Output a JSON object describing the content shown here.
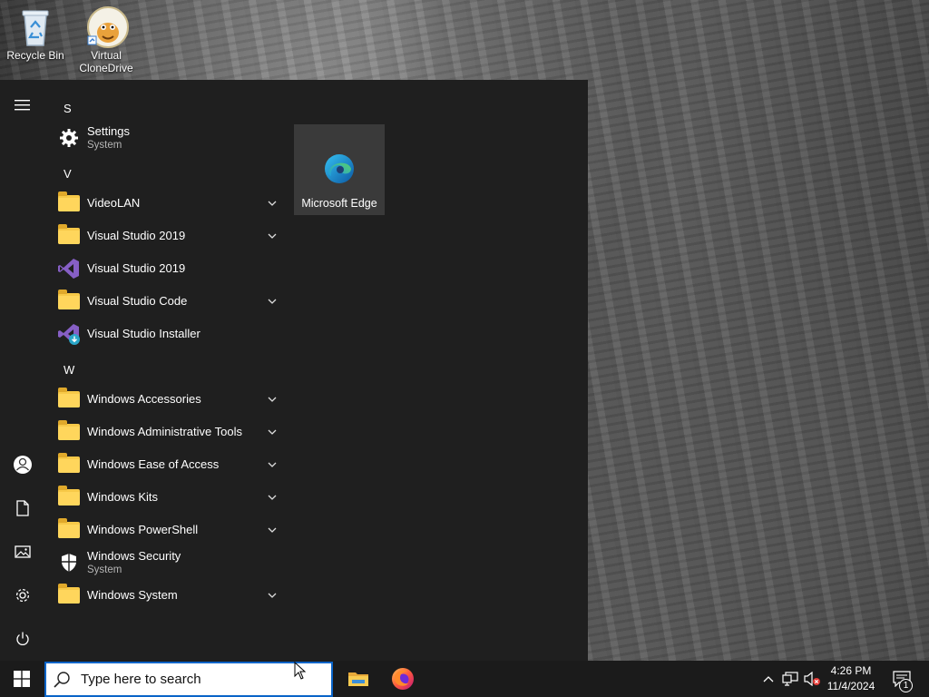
{
  "desktop": {
    "icons": [
      {
        "label": "Recycle Bin",
        "icon": "recycle-bin-icon"
      },
      {
        "label": "Virtual\nCloneDrive",
        "label_line1": "Virtual",
        "label_line2": "CloneDrive",
        "icon": "virtual-clonedrive-sheep-icon"
      }
    ]
  },
  "start_menu": {
    "rail": [
      "hamburger-menu-icon",
      "user-account-icon",
      "documents-icon",
      "pictures-icon",
      "settings-gear-icon",
      "power-icon"
    ],
    "groups": [
      {
        "letter": "S",
        "apps": [
          {
            "name": "Settings",
            "sub": "System",
            "icon": "gear-icon",
            "expandable": false
          }
        ]
      },
      {
        "letter": "V",
        "apps": [
          {
            "name": "VideoLAN",
            "icon": "folder-icon",
            "expandable": true
          },
          {
            "name": "Visual Studio 2019",
            "icon": "folder-icon",
            "expandable": true
          },
          {
            "name": "Visual Studio 2019",
            "icon": "visual-studio-icon",
            "expandable": false
          },
          {
            "name": "Visual Studio Code",
            "icon": "folder-icon",
            "expandable": true
          },
          {
            "name": "Visual Studio Installer",
            "icon": "visual-studio-installer-icon",
            "expandable": false
          }
        ]
      },
      {
        "letter": "W",
        "apps": [
          {
            "name": "Windows Accessories",
            "icon": "folder-icon",
            "expandable": true
          },
          {
            "name": "Windows Administrative Tools",
            "icon": "folder-icon",
            "expandable": true
          },
          {
            "name": "Windows Ease of Access",
            "icon": "folder-icon",
            "expandable": true
          },
          {
            "name": "Windows Kits",
            "icon": "folder-icon",
            "expandable": true
          },
          {
            "name": "Windows PowerShell",
            "icon": "folder-icon",
            "expandable": true
          },
          {
            "name": "Windows Security",
            "sub": "System",
            "icon": "shield-icon",
            "expandable": false
          },
          {
            "name": "Windows System",
            "icon": "folder-icon",
            "expandable": true
          }
        ]
      }
    ],
    "tiles": [
      {
        "name": "Microsoft Edge",
        "icon": "edge-icon"
      }
    ]
  },
  "taskbar": {
    "search_placeholder": "Type here to search",
    "pinned": [
      "file-explorer-icon",
      "firefox-icon"
    ],
    "tray": [
      "chevron-up-icon",
      "network-icon",
      "volume-muted-icon"
    ],
    "time": "4:26 PM",
    "date": "11/4/2024",
    "notification_count": "1"
  },
  "colors": {
    "start_bg": "#1f1f1f",
    "taskbar_bg": "#1b1b1b",
    "tile_bg": "#3a3a3a",
    "accent": "#0a64c8",
    "folder": "#f7c948"
  }
}
